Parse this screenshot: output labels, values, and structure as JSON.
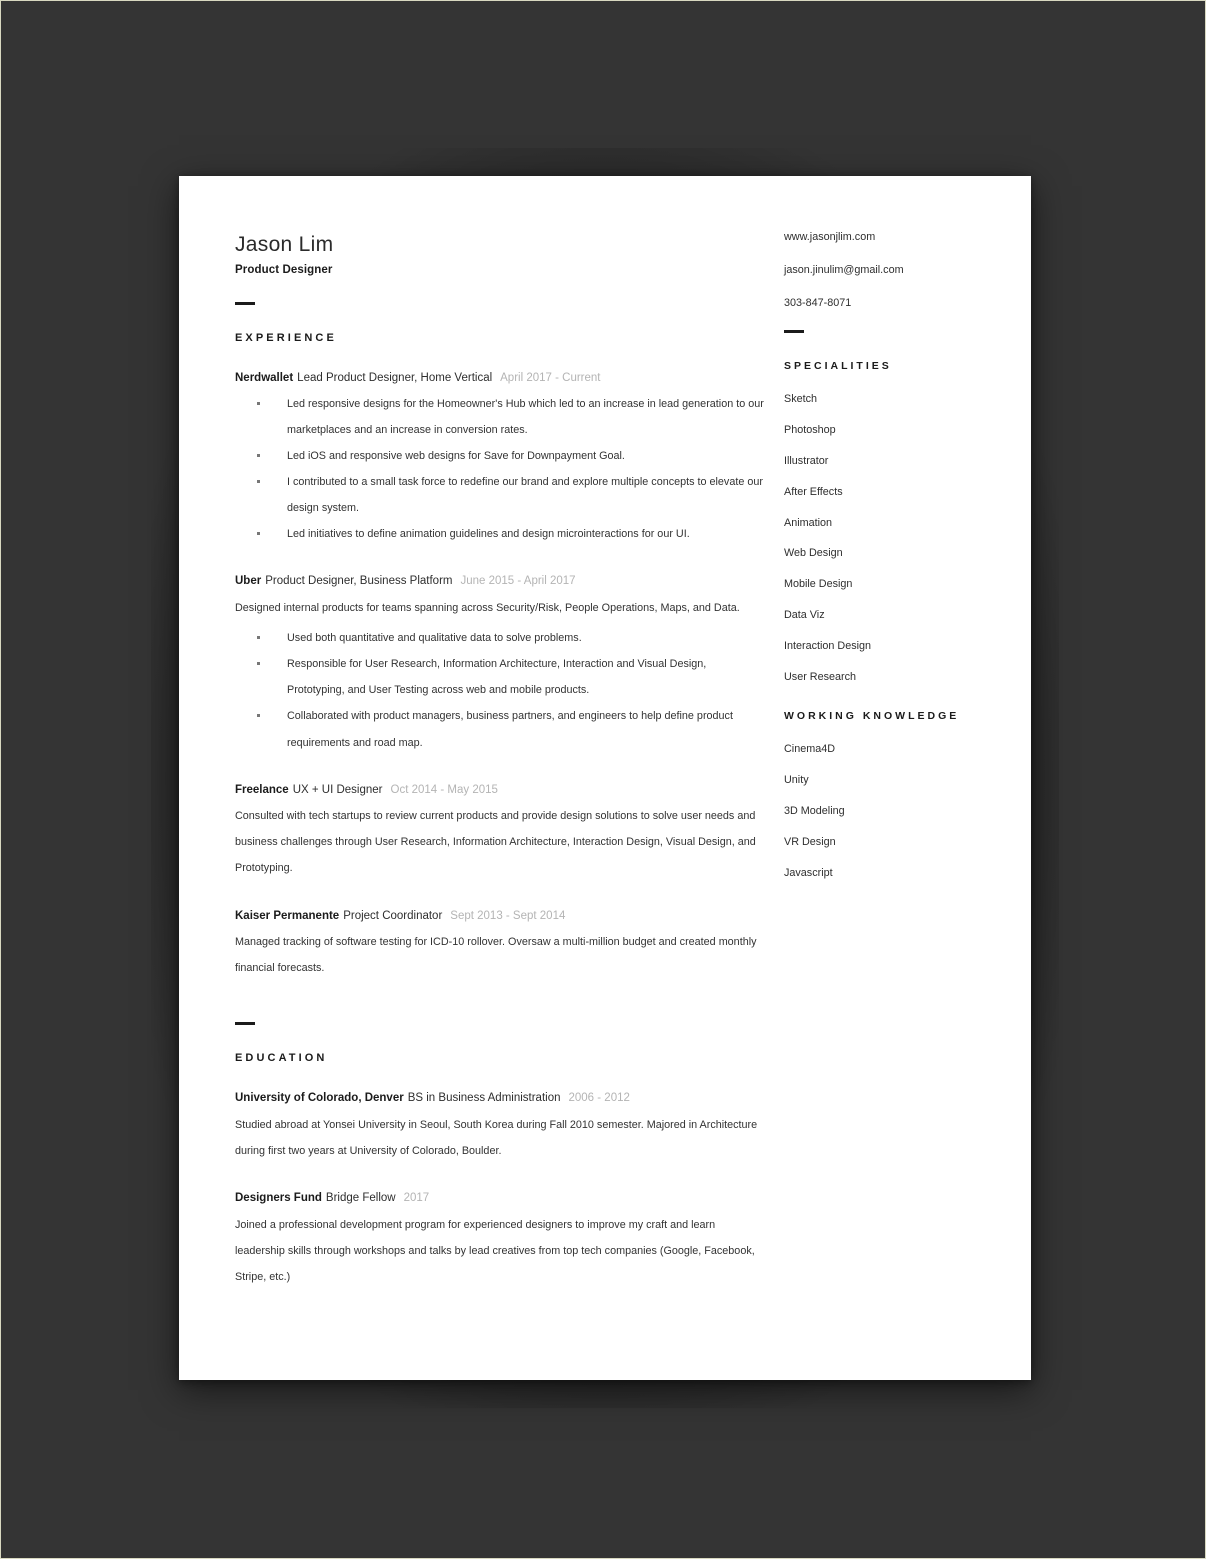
{
  "document": {
    "name": "Jason Lim",
    "role": "Product Designer"
  },
  "contact": {
    "website": "www.jasonjlim.com",
    "email": "jason.jinulim@gmail.com",
    "phone": "303-847-8071"
  },
  "sections": {
    "experience_title": "EXPERIENCE",
    "education_title": "EDUCATION",
    "specialities_title": "SPECIALITIES",
    "working_knowledge_title": "WORKING  KNOWLEDGE"
  },
  "experience": [
    {
      "org": "Nerdwallet",
      "title": "Lead Product Designer, Home Vertical",
      "dates": "April 2017 - Current",
      "description": "",
      "bullets": [
        "Led responsive designs for the Homeowner's Hub which led to an increase in lead generation to our marketplaces and an increase in conversion rates.",
        "Led iOS and responsive web designs for Save for Downpayment Goal.",
        "I contributed to a small task force to redefine our brand and explore multiple concepts to elevate our design system.",
        "Led initiatives to define animation guidelines and design microinteractions for our UI."
      ]
    },
    {
      "org": "Uber",
      "title": "Product Designer, Business Platform",
      "dates": "June 2015 - April 2017",
      "description": "Designed internal products for teams spanning across Security/Risk, People Operations, Maps, and Data.",
      "bullets": [
        "Used both quantitative and qualitative data to solve problems.",
        "Responsible for User Research, Information Architecture, Interaction and Visual Design, Prototyping, and User Testing across web and mobile products.",
        "Collaborated with product managers, business partners, and engineers to help define product requirements and road map."
      ]
    },
    {
      "org": "Freelance",
      "title": "UX + UI Designer",
      "dates": "Oct 2014 - May 2015",
      "description": "Consulted with tech startups to review current products and provide design solutions to solve user needs and business challenges through User Research, Information Architecture, Interaction Design, Visual Design, and Prototyping.",
      "bullets": []
    },
    {
      "org": "Kaiser Permanente",
      "title": "Project Coordinator",
      "dates": "Sept 2013  - Sept 2014",
      "description": "Managed tracking of software testing for ICD-10 rollover. Oversaw a multi-million budget and created monthly financial forecasts.",
      "bullets": []
    }
  ],
  "education": [
    {
      "org": "University of Colorado, Denver",
      "title": "BS in Business Administration",
      "dates": "2006 - 2012",
      "description": "Studied abroad at Yonsei University in Seoul, South Korea during Fall 2010 semester. Majored in Architecture during first two years at University of Colorado, Boulder."
    },
    {
      "org": "Designers Fund",
      "title": "Bridge Fellow",
      "dates": "2017",
      "description": "Joined a professional development program for experienced designers to improve my craft and learn leadership skills through workshops and talks by lead creatives from top tech companies (Google, Facebook, Stripe, etc.)"
    }
  ],
  "specialities": [
    "Sketch",
    "Photoshop",
    "Illustrator",
    "After Effects",
    "Animation",
    "Web Design",
    "Mobile Design",
    "Data Viz",
    "Interaction Design",
    "User Research"
  ],
  "working_knowledge": [
    "Cinema4D",
    "Unity",
    "3D Modeling",
    "VR Design",
    "Javascript"
  ],
  "colors": {
    "background": "#343434",
    "paper": "#ffffff",
    "text": "#333333",
    "heading": "#1b1b1b",
    "muted_date": "#b4b4b4"
  }
}
